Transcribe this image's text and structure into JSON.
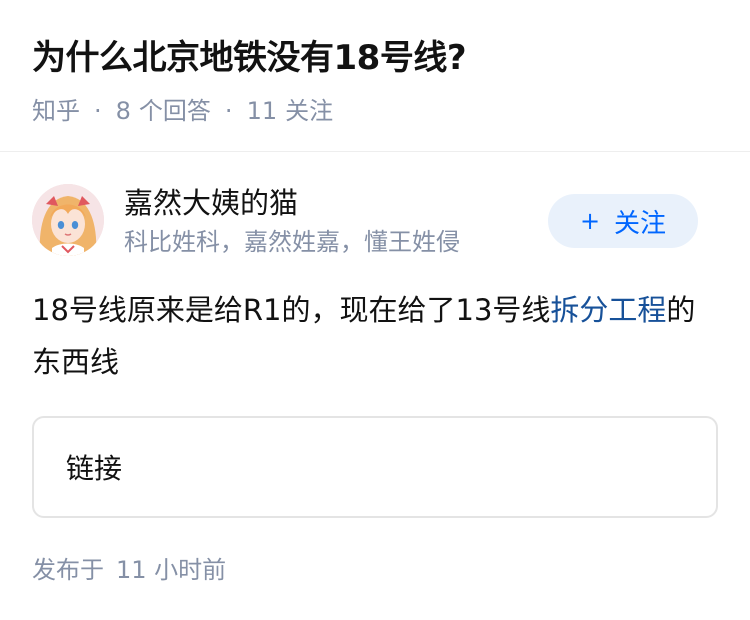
{
  "question": {
    "title": "为什么北京地铁没有18号线?",
    "source": "知乎",
    "answers_count": "8",
    "answers_label": "个回答",
    "followers_count": "11",
    "followers_label": "关注"
  },
  "answer": {
    "author_name": "嘉然大姨的猫",
    "author_bio": "科比姓科，嘉然姓嘉，懂王姓侵",
    "follow_button": "关注",
    "content_before": "18号线原来是给R1的，现在给了13号线",
    "content_link": "拆分工程",
    "content_after": "的东西线",
    "link_card_label": "链接",
    "published_label": "发布于",
    "published_time": "11 小时前"
  },
  "colors": {
    "accent": "#0066ff",
    "link": "#175199",
    "meta": "#8590a6",
    "follow_bg": "#e9f1fb"
  },
  "icons": {
    "avatar": "anime-avatar",
    "follow": "plus-icon"
  }
}
